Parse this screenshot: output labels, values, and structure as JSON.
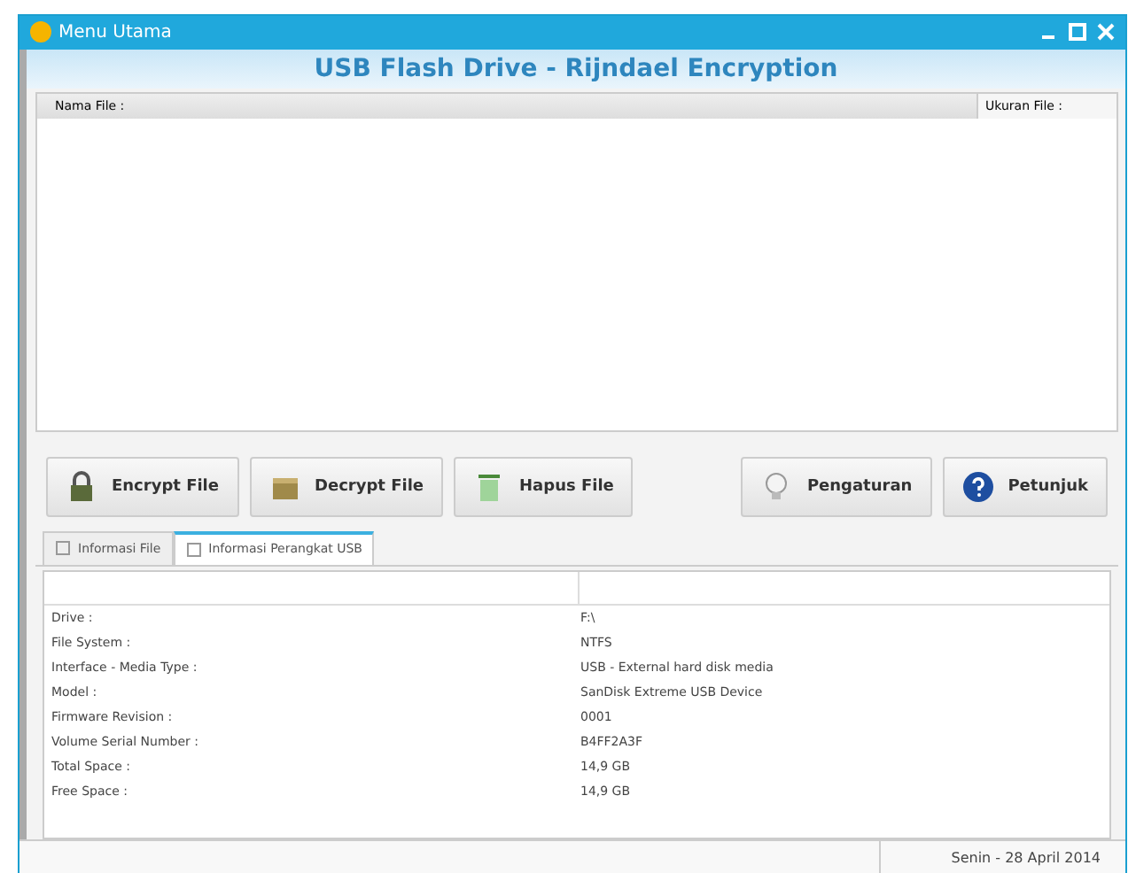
{
  "window": {
    "title": "Menu Utama"
  },
  "header": "USB Flash Drive - Rijndael Encryption",
  "file_table": {
    "columns": [
      "Nama File :",
      "Ukuran File :"
    ]
  },
  "buttons": [
    {
      "label": "Encrypt File",
      "kind": "encrypt"
    },
    {
      "label": "Decrypt File",
      "kind": "decrypt"
    },
    {
      "label": "Hapus File",
      "kind": "delete"
    },
    {
      "label": "Pengaturan",
      "kind": "settings"
    },
    {
      "label": "Petunjuk",
      "kind": "help"
    }
  ],
  "tabs": [
    {
      "label": "Informasi File",
      "selected": false
    },
    {
      "label": "Informasi Perangkat USB",
      "selected": true
    }
  ],
  "info_rows": [
    {
      "label": "Drive :",
      "value": "F:\\"
    },
    {
      "label": "File System :",
      "value": "NTFS"
    },
    {
      "label": "Interface - Media Type :",
      "value": "USB - External hard disk media"
    },
    {
      "label": "Model :",
      "value": "SanDisk Extreme USB Device"
    },
    {
      "label": "Firmware Revision :",
      "value": "0001"
    },
    {
      "label": "Volume Serial Number :",
      "value": "B4FF2A3F"
    },
    {
      "label": "Total Space :",
      "value": "14,9 GB"
    },
    {
      "label": "Free Space :",
      "value": "14,9 GB"
    }
  ],
  "status_bar": "Senin - 28 April 2014"
}
